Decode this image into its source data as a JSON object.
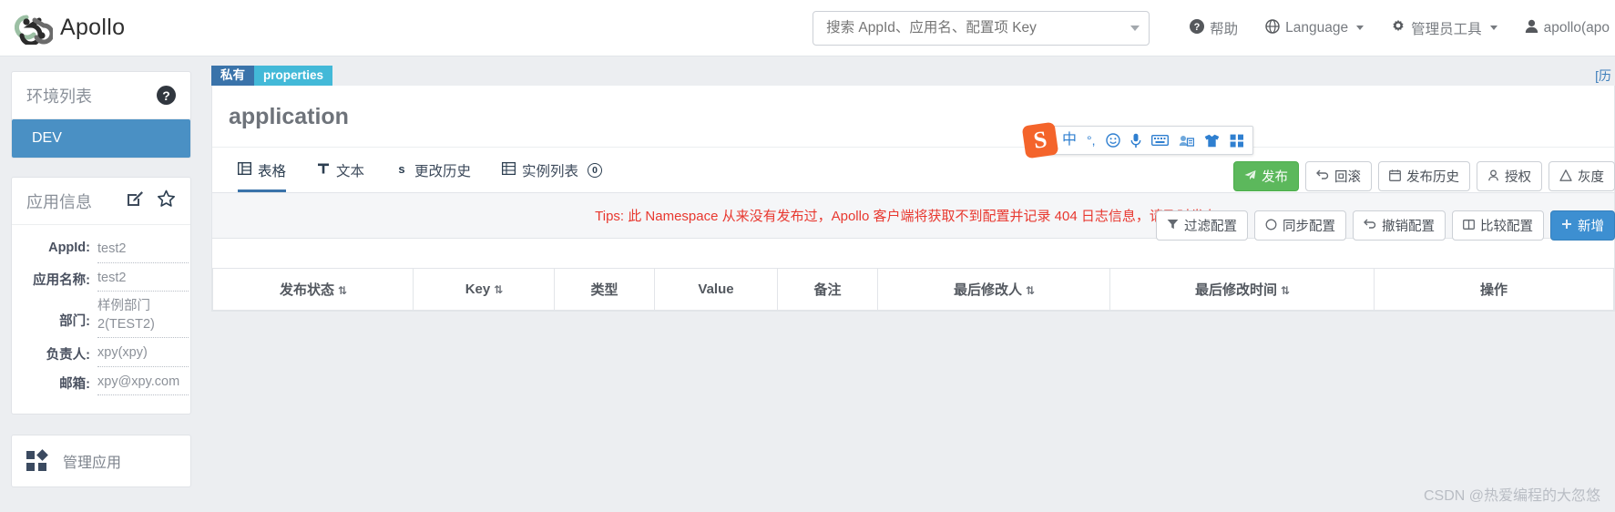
{
  "navbar": {
    "brand": "Apollo",
    "search": {
      "placeholder": "搜索 AppId、应用名、配置项 Key",
      "value": ""
    },
    "items": [
      {
        "icon": "question-circle-icon",
        "label": "帮助",
        "caret": false
      },
      {
        "icon": "globe-icon",
        "label": "Language",
        "caret": true
      },
      {
        "icon": "gear-icon",
        "label": "管理员工具",
        "caret": true
      },
      {
        "icon": "user-icon",
        "label": "apollo(apo",
        "caret": false
      }
    ]
  },
  "sidebar": {
    "env_panel": {
      "title": "环境列表",
      "help_icon": "question-mark-icon"
    },
    "env_items": [
      {
        "label": "DEV",
        "active": true
      }
    ],
    "app_panel": {
      "title": "应用信息",
      "edit_icon": "edit-pencil-icon",
      "favorite_icon": "star-icon",
      "fields": [
        {
          "label": "AppId:",
          "value": "test2"
        },
        {
          "label": "应用名称:",
          "value": "test2"
        },
        {
          "label": "部门:",
          "value": "样例部门2(TEST2)"
        },
        {
          "label": "负责人:",
          "value": "xpy(xpy)"
        },
        {
          "label": "邮箱:",
          "value": "xpy@xpy.com"
        }
      ]
    },
    "manage_app": {
      "label": "管理应用",
      "icon": "grid-squares-icon"
    }
  },
  "main": {
    "namespace_tags": [
      {
        "label": "私有",
        "style": "private"
      },
      {
        "label": "properties",
        "style": "props"
      }
    ],
    "namespace_right_text": "[历",
    "title": "application",
    "tabs": [
      {
        "label": "表格",
        "icon": "table-icon",
        "active": true,
        "badge": null
      },
      {
        "label": "文本",
        "icon": "text-T-icon",
        "active": false,
        "badge": null
      },
      {
        "label": "更改历史",
        "icon": "history-s-icon",
        "active": false,
        "badge": null
      },
      {
        "label": "实例列表",
        "icon": "instances-icon",
        "active": false,
        "badge": "0"
      }
    ],
    "tips": "Tips: 此 Namespace 从来没有发布过，Apollo 客户端将获取不到配置并记录 404 日志信息，请及时发布。",
    "toolbar_primary": [
      {
        "label": "发布",
        "icon": "send-icon",
        "style": "green"
      },
      {
        "label": "回滚",
        "icon": "rollback-arrow-icon",
        "style": "default"
      },
      {
        "label": "发布历史",
        "icon": "calendar-icon",
        "style": "default"
      },
      {
        "label": "授权",
        "icon": "person-key-icon",
        "style": "default"
      },
      {
        "label": "灰度",
        "icon": "flask-icon",
        "style": "default"
      }
    ],
    "toolbar_secondary": [
      {
        "label": "过滤配置",
        "icon": "filter-icon",
        "style": "default"
      },
      {
        "label": "同步配置",
        "icon": "circle-sync-icon",
        "style": "default"
      },
      {
        "label": "撤销配置",
        "icon": "undo-arrow-icon",
        "style": "default"
      },
      {
        "label": "比较配置",
        "icon": "compare-icon",
        "style": "default"
      },
      {
        "label": "新增",
        "icon": "plus-icon",
        "style": "blue"
      }
    ],
    "table_headers": [
      {
        "label": "发布状态",
        "sortable": true
      },
      {
        "label": "Key",
        "sortable": true
      },
      {
        "label": "类型",
        "sortable": false
      },
      {
        "label": "Value",
        "sortable": false
      },
      {
        "label": "备注",
        "sortable": false
      },
      {
        "label": "最后修改人",
        "sortable": true
      },
      {
        "label": "最后修改时间",
        "sortable": true
      },
      {
        "label": "操作",
        "sortable": false
      }
    ],
    "table_rows": []
  },
  "ime_toolbar": {
    "logo": "S",
    "buttons": [
      {
        "icon": "chinese-mode-icon",
        "glyph": "中"
      },
      {
        "icon": "punctuation-icon",
        "glyph": "°,"
      },
      {
        "icon": "emoji-icon",
        "glyph": "☺"
      },
      {
        "icon": "microphone-icon",
        "glyph": "🎤"
      },
      {
        "icon": "keyboard-icon",
        "glyph": "⌨"
      },
      {
        "icon": "user-card-icon",
        "glyph": "▤"
      },
      {
        "icon": "skin-shirt-icon",
        "glyph": "👕"
      },
      {
        "icon": "apps-grid-icon",
        "glyph": "▦"
      }
    ]
  },
  "watermark": "CSDN @热爱编程的大忽悠",
  "colors": {
    "accent_blue": "#4a90c4",
    "publish_green": "#5cb85c",
    "tips_red": "#e8382f",
    "tag_private": "#3a73aa",
    "tag_props": "#43b9d8"
  }
}
